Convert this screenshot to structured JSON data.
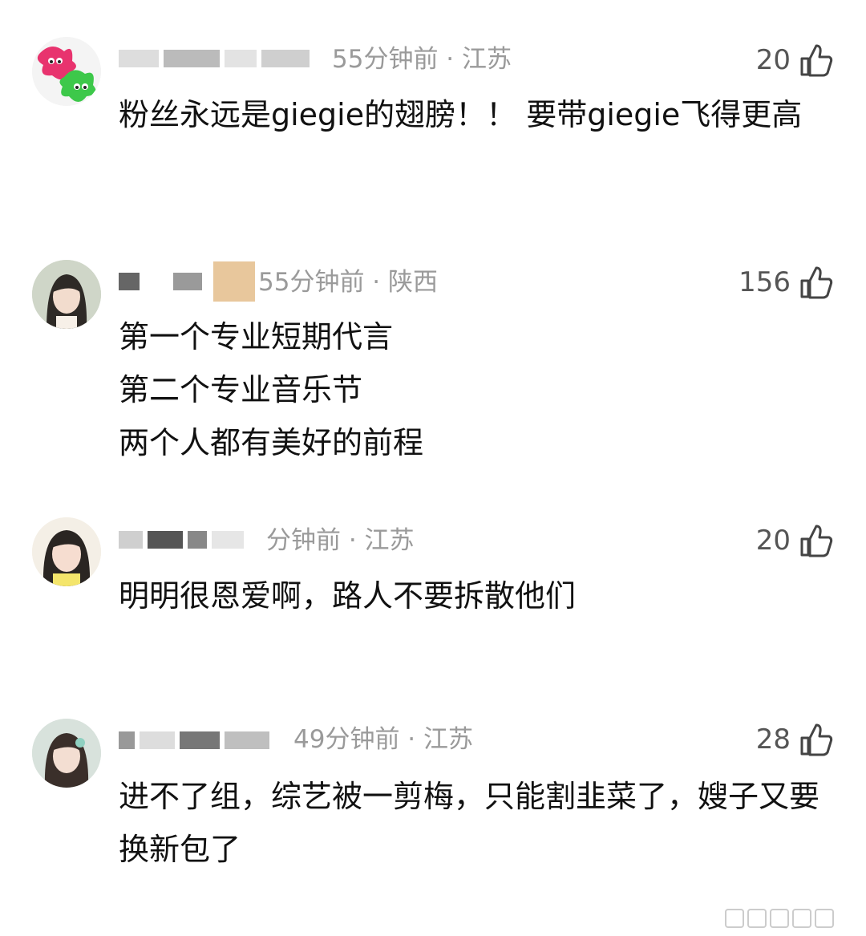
{
  "comments": [
    {
      "time_location": "55分钟前 · 江苏",
      "likes": "20",
      "text": "粉丝永远是giegie的翅膀！！ 要带giegie飞得更高",
      "avatar_icon": "cartoon-splat-avatar"
    },
    {
      "time_location": "55分钟前 · 陕西",
      "likes": "156",
      "text": "第一个专业短期代言\n第二个专业音乐节\n两个人都有美好的前程",
      "avatar_icon": "girl-photo-avatar"
    },
    {
      "time_location": "分钟前 · 江苏",
      "likes": "20",
      "text": "明明很恩爱啊，路人不要拆散他们",
      "avatar_icon": "girl-photo-avatar"
    },
    {
      "time_location": "49分钟前 · 江苏",
      "likes": "28",
      "text": "进不了组，综艺被一剪梅，只能割韭菜了，嫂子又要换新包了",
      "avatar_icon": "girl-photo-avatar"
    }
  ],
  "colors": {
    "meta_gray": "#9a9a9a",
    "text_black": "#111111",
    "like_gray": "#555555"
  }
}
